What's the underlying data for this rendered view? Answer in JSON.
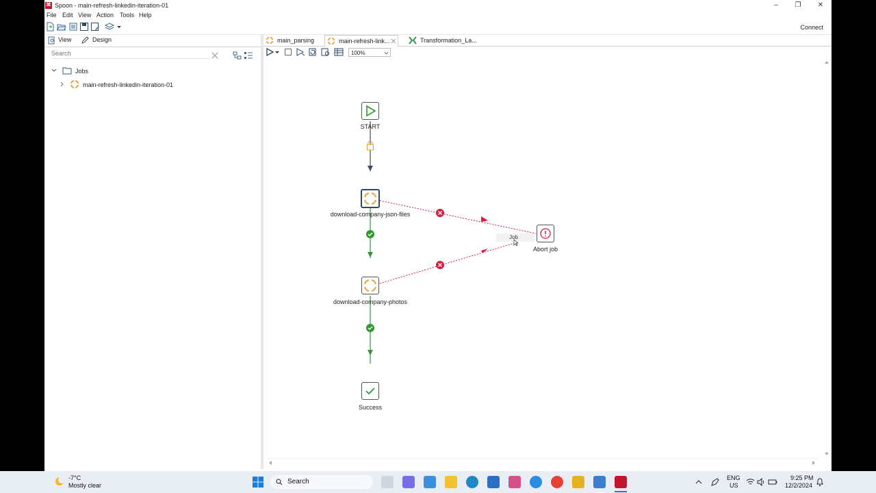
{
  "window": {
    "title": "Spoon - main-refresh-linkedin-iteration-01",
    "app_icon_text": "⌘",
    "controls": {
      "minimize": "–",
      "maximize": "❐",
      "close": "✕"
    }
  },
  "menu": [
    "File",
    "Edit",
    "View",
    "Action",
    "Tools",
    "Help"
  ],
  "toolbar": {
    "connect_label": "Connect"
  },
  "left_panel": {
    "tabs": {
      "view": "View",
      "design": "Design"
    },
    "search_placeholder": "Search",
    "tree": {
      "root": "Jobs",
      "child": "main-refresh-linkedin-iteration-01"
    }
  },
  "editor": {
    "tabs": [
      "main_parsing",
      "main-refresh-link...",
      "Transformation_La..."
    ],
    "zoom": "100%"
  },
  "canvas": {
    "nodes": {
      "start": "START",
      "download_json": "download-company-json-files",
      "download_photos": "download-company-photos",
      "success": "Success",
      "abort": "Abort job"
    },
    "tooltip": "Job"
  },
  "colors": {
    "success": "#2e9a2e",
    "error": "#d81b3f",
    "lock": "#e2a21c",
    "accent_orange": "#e8a33a",
    "hop_dark": "#3a4c5e"
  },
  "taskbar": {
    "weather_temp": "-7°C",
    "weather_desc": "Mostly clear",
    "search": "Search",
    "lang_top": "ENG",
    "lang_bottom": "US",
    "time": "9:25 PM",
    "date": "12/2/2024"
  }
}
